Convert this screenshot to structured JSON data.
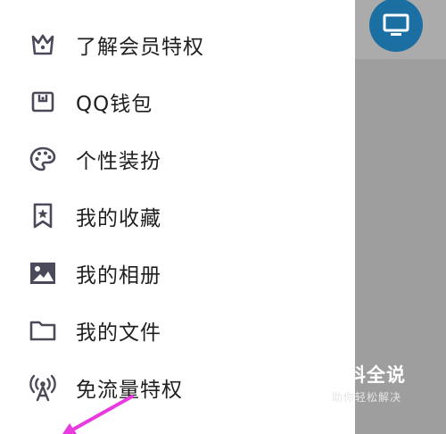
{
  "menu": {
    "items": [
      {
        "label": "了解会员特权",
        "icon": "crown-icon"
      },
      {
        "label": "QQ钱包",
        "icon": "wallet-icon"
      },
      {
        "label": "个性装扮",
        "icon": "palette-icon"
      },
      {
        "label": "我的收藏",
        "icon": "bookmark-star-icon"
      },
      {
        "label": "我的相册",
        "icon": "image-icon"
      },
      {
        "label": "我的文件",
        "icon": "folder-icon"
      },
      {
        "label": "免流量特权",
        "icon": "signal-tower-icon"
      }
    ]
  },
  "watermark": {
    "title": "百科全说",
    "subtitle": "助你轻松解决"
  },
  "colors": {
    "icon": "#4a4a5a",
    "overlay": "#9e9e9e",
    "avatar": "#1b6fa2",
    "arrow": "#e83adf"
  }
}
